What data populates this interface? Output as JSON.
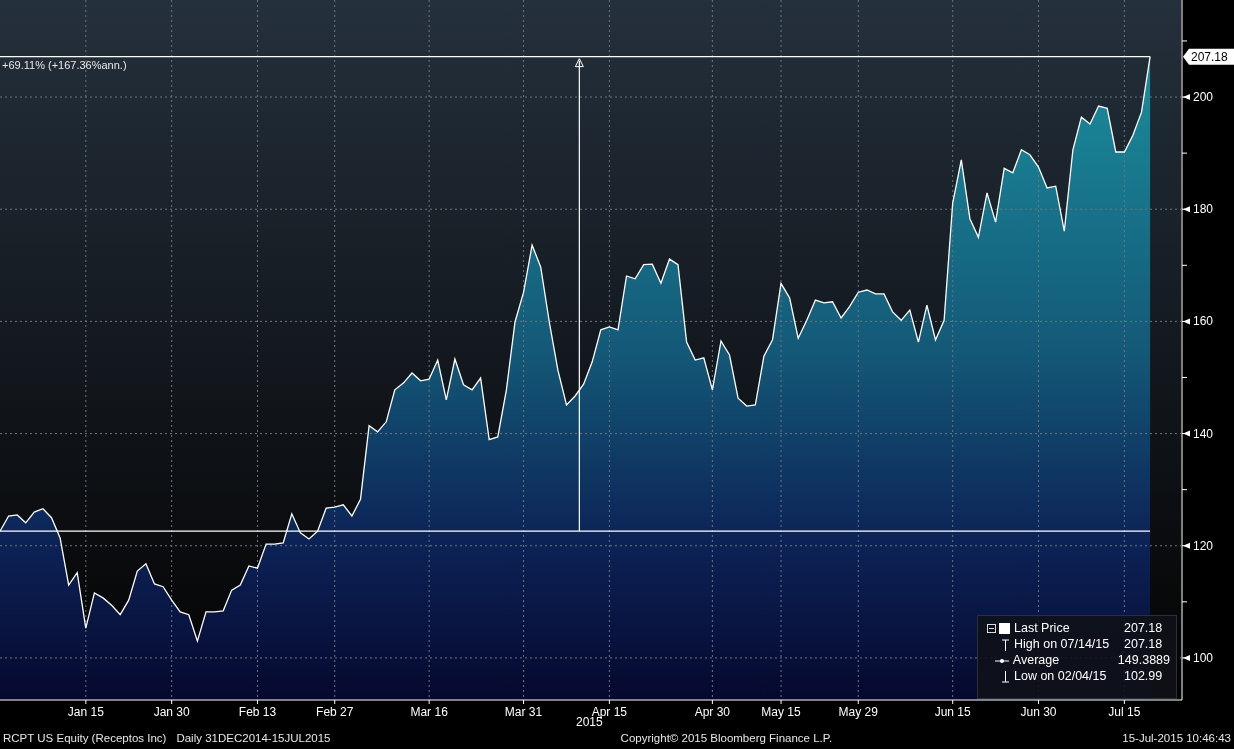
{
  "chart": {
    "chart_data": {
      "type": "area",
      "xlabel": "2015",
      "categories": [
        null,
        null,
        null,
        null,
        null,
        null,
        null,
        null,
        null,
        null,
        "Jan 15",
        null,
        null,
        null,
        null,
        null,
        null,
        null,
        null,
        null,
        "Jan 30",
        null,
        null,
        null,
        null,
        null,
        null,
        null,
        null,
        null,
        "Feb 13",
        null,
        null,
        null,
        null,
        null,
        null,
        null,
        null,
        "Feb 27",
        null,
        null,
        null,
        null,
        null,
        null,
        null,
        null,
        null,
        null,
        "Mar 16",
        null,
        null,
        null,
        null,
        null,
        null,
        null,
        null,
        null,
        null,
        "Mar 31",
        null,
        null,
        null,
        null,
        null,
        null,
        null,
        null,
        null,
        "Apr 15",
        null,
        null,
        null,
        null,
        null,
        null,
        null,
        null,
        null,
        null,
        null,
        "Apr 30",
        null,
        null,
        null,
        null,
        null,
        null,
        null,
        "May 15",
        null,
        null,
        null,
        null,
        null,
        null,
        null,
        null,
        "May 29",
        null,
        null,
        null,
        null,
        null,
        null,
        null,
        null,
        null,
        null,
        "Jun 15",
        null,
        null,
        null,
        null,
        null,
        null,
        null,
        null,
        null,
        "Jun 30",
        null,
        null,
        null,
        null,
        null,
        null,
        null,
        null,
        null,
        "Jul 15",
        null,
        null,
        null
      ],
      "series": [
        {
          "name": "Last Price",
          "color": "#ffffff",
          "values": [
            122.6,
            125.3,
            125.5,
            124.1,
            126.0,
            126.6,
            125.0,
            121.4,
            113.0,
            115.2,
            105.3,
            111.6,
            110.7,
            109.4,
            107.7,
            110.3,
            115.5,
            116.8,
            113.2,
            112.7,
            110.3,
            108.2,
            107.7,
            103.0,
            108.2,
            108.2,
            108.4,
            112.1,
            113.0,
            116.4,
            116.0,
            120.3,
            120.3,
            120.5,
            125.7,
            122.3,
            121.2,
            122.6,
            126.7,
            126.9,
            127.3,
            125.3,
            128.3,
            141.4,
            140.3,
            142.1,
            147.8,
            149.0,
            150.8,
            149.4,
            149.7,
            153.1,
            146.0,
            153.3,
            148.7,
            147.8,
            149.9,
            138.9,
            139.4,
            147.8,
            159.9,
            165.2,
            173.6,
            169.7,
            159.9,
            151.3,
            145.1,
            146.7,
            148.8,
            152.8,
            158.5,
            159.0,
            158.5,
            168.1,
            167.6,
            170.1,
            170.2,
            166.8,
            171.1,
            170.1,
            156.3,
            153.1,
            153.5,
            147.8,
            156.5,
            154.0,
            146.3,
            144.9,
            145.1,
            153.8,
            156.7,
            166.8,
            164.2,
            157.0,
            160.2,
            163.8,
            163.3,
            163.5,
            160.6,
            162.7,
            165.2,
            165.6,
            164.9,
            164.9,
            161.7,
            160.2,
            162.0,
            156.3,
            162.9,
            156.7,
            160.2,
            181.1,
            188.8,
            178.3,
            175.0,
            182.9,
            177.7,
            187.3,
            186.5,
            190.6,
            189.7,
            187.5,
            183.8,
            184.1,
            176.1,
            190.6,
            196.4,
            195.2,
            198.4,
            198.0,
            190.2,
            190.2,
            193.2,
            197.3,
            207.2
          ]
        }
      ],
      "ylim": [
        92.5,
        217.3
      ],
      "yticks": [
        100,
        120,
        140,
        160,
        180,
        200
      ],
      "grid": true,
      "annotations": [
        "+69.11% (+167.36%ann.)",
        "207.18"
      ]
    },
    "legend": [
      {
        "kind": "last",
        "value": "207.18"
      },
      {
        "kind": "high",
        "label": "High on 07/14/15",
        "value": "207.18"
      },
      {
        "kind": "average",
        "label": "Average",
        "value": "149.3889"
      },
      {
        "kind": "low",
        "label": "Low on 02/04/15",
        "value": "102.99"
      }
    ]
  },
  "footer": {
    "security": "RCPT US Equity (Receptos Inc)",
    "range": "Daily 31DEC2014-15JUL2015",
    "copyright": "Copyright© 2015 Bloomberg Finance L.P.",
    "timestamp": "15-Jul-2015 10:46:43"
  }
}
